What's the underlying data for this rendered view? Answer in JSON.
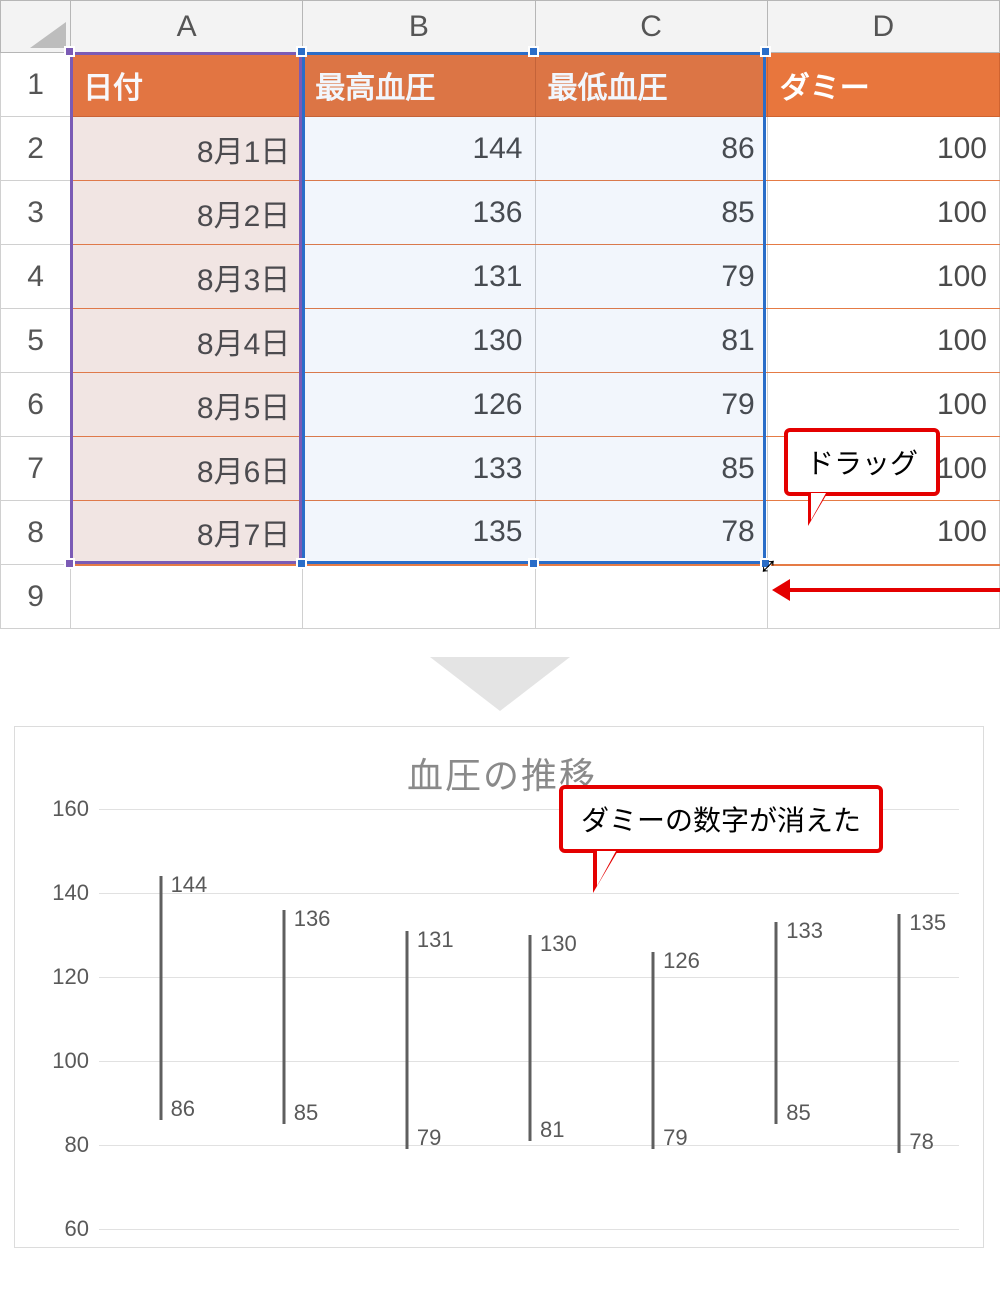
{
  "sheet": {
    "column_letters": [
      "A",
      "B",
      "C",
      "D"
    ],
    "row_numbers": [
      "1",
      "2",
      "3",
      "4",
      "5",
      "6",
      "7",
      "8",
      "9"
    ],
    "header": {
      "date_label": "日付",
      "high_label": "最高血圧",
      "low_label": "最低血圧",
      "dummy_label": "ダミー"
    },
    "rows": [
      {
        "date": "8月1日",
        "high": "144",
        "low": "86",
        "dummy": "100"
      },
      {
        "date": "8月2日",
        "high": "136",
        "low": "85",
        "dummy": "100"
      },
      {
        "date": "8月3日",
        "high": "131",
        "low": "79",
        "dummy": "100"
      },
      {
        "date": "8月4日",
        "high": "130",
        "low": "81",
        "dummy": "100"
      },
      {
        "date": "8月5日",
        "high": "126",
        "low": "79",
        "dummy": "100"
      },
      {
        "date": "8月6日",
        "high": "133",
        "low": "85",
        "dummy": "100"
      },
      {
        "date": "8月7日",
        "high": "135",
        "low": "78",
        "dummy": "100"
      }
    ],
    "callout_drag": "ドラッグ"
  },
  "chart": {
    "title": "血圧の推移",
    "callout": "ダミーの数字が消えた"
  },
  "chart_data": {
    "type": "bar",
    "title": "血圧の推移",
    "xlabel": "",
    "ylabel": "",
    "categories": [
      "8月1日",
      "8月2日",
      "8月3日",
      "8月4日",
      "8月5日",
      "8月6日",
      "8月7日"
    ],
    "series": [
      {
        "name": "最高血圧",
        "values": [
          144,
          136,
          131,
          130,
          126,
          133,
          135
        ]
      },
      {
        "name": "最低血圧",
        "values": [
          86,
          85,
          79,
          81,
          79,
          85,
          78
        ]
      }
    ],
    "ylim": [
      60,
      160
    ],
    "yticks": [
      60,
      80,
      100,
      120,
      140,
      160
    ],
    "grid": true,
    "legend": false
  }
}
